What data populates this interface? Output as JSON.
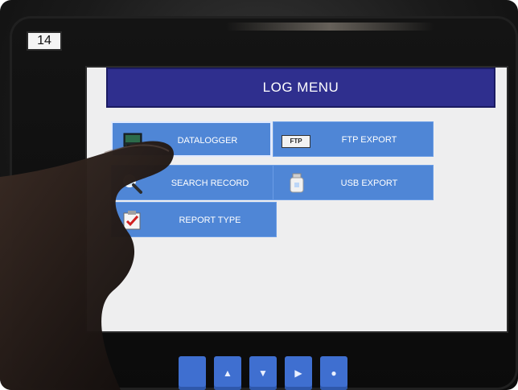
{
  "badge": "14",
  "screen": {
    "title": "LOG MENU",
    "tiles": [
      {
        "label": "DATALOGGER",
        "icon": "datalogger-icon"
      },
      {
        "label": "FTP EXPORT",
        "icon": "ftp-icon",
        "icon_text": "FTP"
      },
      {
        "label": "SEARCH RECORD",
        "icon": "magnifier-icon"
      },
      {
        "label": "USB EXPORT",
        "icon": "usb-drive-icon"
      },
      {
        "label": "REPORT TYPE",
        "icon": "clipboard-check-icon"
      }
    ],
    "colors": {
      "title_bar": "#2f2f8e",
      "tile": "#4f86d6",
      "background": "#eeeeef"
    }
  },
  "hardware_keys": [
    {
      "name": "blank-key",
      "glyph": ""
    },
    {
      "name": "up-arrow-key",
      "glyph": "▲"
    },
    {
      "name": "down-arrow-key",
      "glyph": "▼"
    },
    {
      "name": "right-arrow-key",
      "glyph": "▶"
    },
    {
      "name": "enter-key",
      "glyph": "●"
    }
  ]
}
